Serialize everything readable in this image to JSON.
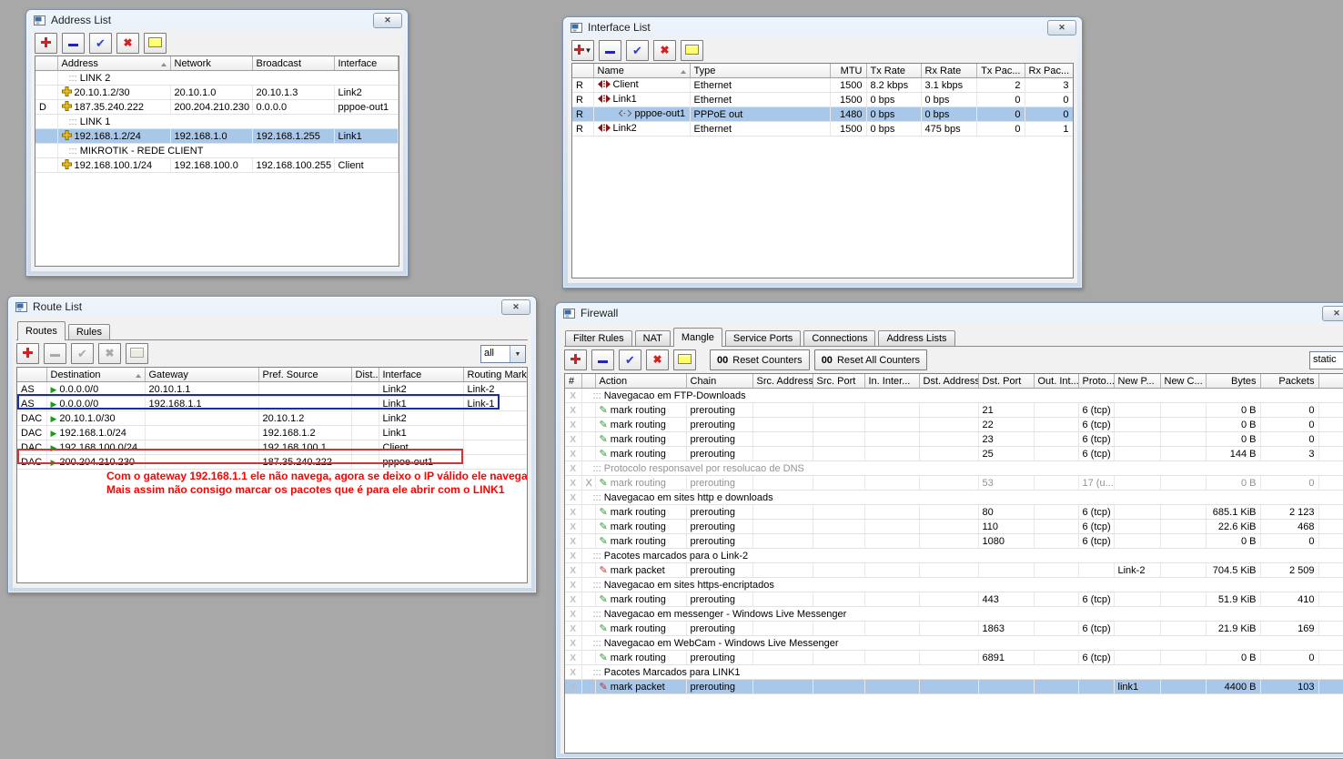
{
  "desktop": {
    "background_color": "#a8a8a8"
  },
  "colors": {
    "selection": "#a9c7e9",
    "annotation_red": "#ff0000",
    "outline_blue": "#1c2f9e",
    "outline_red": "#d03434"
  },
  "windows": {
    "address_list": {
      "title": "Address List",
      "toolbar": [
        {
          "icon": "add-icon"
        },
        {
          "icon": "remove-icon"
        },
        {
          "icon": "enable-icon"
        },
        {
          "icon": "disable-icon"
        },
        {
          "icon": "comment-icon"
        }
      ],
      "columns": [
        "Address",
        "Network",
        "Broadcast",
        "Interface"
      ],
      "sort_column": "Address",
      "rows": [
        {
          "kind": "comment",
          "text": "LINK 2"
        },
        {
          "kind": "item",
          "flag": "",
          "icon": "address-icon",
          "address": "20.10.1.2/30",
          "network": "20.10.1.0",
          "broadcast": "20.10.1.3",
          "interface": "Link2"
        },
        {
          "kind": "item",
          "flag": "D",
          "icon": "address-icon",
          "address": "187.35.240.222",
          "network": "200.204.210.230",
          "broadcast": "0.0.0.0",
          "interface": "pppoe-out1"
        },
        {
          "kind": "comment",
          "text": "LINK 1"
        },
        {
          "kind": "item",
          "flag": "",
          "icon": "address-icon",
          "address": "192.168.1.2/24",
          "network": "192.168.1.0",
          "broadcast": "192.168.1.255",
          "interface": "Link1",
          "selected": true
        },
        {
          "kind": "comment",
          "text": "MIKROTIK - REDE CLIENT"
        },
        {
          "kind": "item",
          "flag": "",
          "icon": "address-icon",
          "address": "192.168.100.1/24",
          "network": "192.168.100.0",
          "broadcast": "192.168.100.255",
          "interface": "Client"
        }
      ]
    },
    "interface_list": {
      "title": "Interface List",
      "toolbar": [
        {
          "icon": "add-icon",
          "caret": true
        },
        {
          "icon": "remove-icon"
        },
        {
          "icon": "enable-icon"
        },
        {
          "icon": "disable-icon"
        },
        {
          "icon": "comment-icon"
        }
      ],
      "columns": [
        "Name",
        "Type",
        "MTU",
        "Tx Rate",
        "Rx Rate",
        "Tx Pac...",
        "Rx Pac..."
      ],
      "sort_column": "Name",
      "rows": [
        {
          "flag": "R",
          "icon": "ethernet-icon",
          "name": "Client",
          "type": "Ethernet",
          "mtu": "1500",
          "tx_rate": "8.2 kbps",
          "rx_rate": "3.1 kbps",
          "tx_pac": "2",
          "rx_pac": "3"
        },
        {
          "flag": "R",
          "icon": "ethernet-icon",
          "name": "Link1",
          "type": "Ethernet",
          "mtu": "1500",
          "tx_rate": "0 bps",
          "rx_rate": "0 bps",
          "tx_pac": "0",
          "rx_pac": "0"
        },
        {
          "flag": "R",
          "icon": "pppoe-icon",
          "indent": true,
          "name": "pppoe-out1",
          "type": "PPPoE out",
          "mtu": "1480",
          "tx_rate": "0 bps",
          "rx_rate": "0 bps",
          "tx_pac": "0",
          "rx_pac": "0",
          "selected": true
        },
        {
          "flag": "R",
          "icon": "ethernet-icon",
          "name": "Link2",
          "type": "Ethernet",
          "mtu": "1500",
          "tx_rate": "0 bps",
          "rx_rate": "475 bps",
          "tx_pac": "0",
          "rx_pac": "1"
        }
      ]
    },
    "route_list": {
      "title": "Route List",
      "tabs": [
        {
          "label": "Routes",
          "active": true
        },
        {
          "label": "Rules"
        }
      ],
      "toolbar": [
        {
          "icon": "add-icon"
        },
        {
          "icon": "remove-icon",
          "disabled": true
        },
        {
          "icon": "enable-icon",
          "disabled": true
        },
        {
          "icon": "disable-icon",
          "disabled": true
        },
        {
          "icon": "comment-icon",
          "disabled": true
        }
      ],
      "filter_value": "all",
      "columns": [
        "Destination",
        "Gateway",
        "Pref. Source",
        "Dist...",
        "Interface",
        "Routing Mark"
      ],
      "sort_column": "Destination",
      "rows": [
        {
          "flags": "AS",
          "icon": "route-flag-icon",
          "destination": "0.0.0.0/0",
          "gateway": "20.10.1.1",
          "pref_source": "",
          "distance": "",
          "interface": "Link2",
          "routing_mark": "Link-2"
        },
        {
          "flags": "AS",
          "icon": "route-flag-icon",
          "destination": "0.0.0.0/0",
          "gateway": "192.168.1.1",
          "pref_source": "",
          "distance": "",
          "interface": "Link1",
          "routing_mark": "Link-1",
          "outline": "blue"
        },
        {
          "flags": "DAC",
          "icon": "route-flag-icon",
          "destination": "20.10.1.0/30",
          "gateway": "",
          "pref_source": "20.10.1.2",
          "distance": "",
          "interface": "Link2",
          "routing_mark": ""
        },
        {
          "flags": "DAC",
          "icon": "route-flag-icon",
          "destination": "192.168.1.0/24",
          "gateway": "",
          "pref_source": "192.168.1.2",
          "distance": "",
          "interface": "Link1",
          "routing_mark": ""
        },
        {
          "flags": "DAC",
          "icon": "route-flag-icon",
          "destination": "192.168.100.0/24",
          "gateway": "",
          "pref_source": "192.168.100.1",
          "distance": "",
          "interface": "Client",
          "routing_mark": ""
        },
        {
          "flags": "DAC",
          "icon": "route-flag-icon",
          "destination": "200.204.210.230",
          "gateway": "",
          "pref_source": "187.35.240.222",
          "distance": "",
          "interface": "pppoe-out1",
          "routing_mark": "",
          "outline": "red"
        }
      ],
      "annotation": {
        "color": "#ff0000",
        "lines": [
          "Com o gateway 192.168.1.1 ele não navega, agora se deixo o IP válido ele navega.",
          "Mais assim não consigo marcar os pacotes que é para ele abrir com o LINK1"
        ]
      }
    },
    "firewall": {
      "title": "Firewall",
      "tabs": [
        {
          "label": "Filter Rules"
        },
        {
          "label": "NAT"
        },
        {
          "label": "Mangle",
          "active": true
        },
        {
          "label": "Service Ports"
        },
        {
          "label": "Connections"
        },
        {
          "label": "Address Lists"
        }
      ],
      "toolbar": [
        {
          "icon": "add-icon"
        },
        {
          "icon": "remove-icon"
        },
        {
          "icon": "enable-icon"
        },
        {
          "icon": "disable-icon"
        },
        {
          "icon": "comment-icon"
        }
      ],
      "buttons": [
        {
          "prefix": "00",
          "label": "Reset Counters"
        },
        {
          "prefix": "00",
          "label": "Reset All Counters"
        }
      ],
      "filter_value": "static",
      "columns": [
        "#",
        "Action",
        "Chain",
        "Src. Address",
        "Src. Port",
        "In. Inter...",
        "Dst. Address",
        "Dst. Port",
        "Out. Int...",
        "Proto...",
        "New P...",
        "New C...",
        "Bytes",
        "Packets"
      ],
      "rows": [
        {
          "kind": "comment",
          "text": "Navegacao em FTP-Downloads"
        },
        {
          "kind": "rule",
          "icon": "mark-routing-icon",
          "action": "mark routing",
          "chain": "prerouting",
          "dst_port": "21",
          "proto": "6 (tcp)",
          "new_packet_mark": "",
          "bytes": "0 B",
          "packets": "0"
        },
        {
          "kind": "rule",
          "icon": "mark-routing-icon",
          "action": "mark routing",
          "chain": "prerouting",
          "dst_port": "22",
          "proto": "6 (tcp)",
          "new_packet_mark": "",
          "bytes": "0 B",
          "packets": "0"
        },
        {
          "kind": "rule",
          "icon": "mark-routing-icon",
          "action": "mark routing",
          "chain": "prerouting",
          "dst_port": "23",
          "proto": "6 (tcp)",
          "new_packet_mark": "",
          "bytes": "0 B",
          "packets": "0"
        },
        {
          "kind": "rule",
          "icon": "mark-routing-icon",
          "action": "mark routing",
          "chain": "prerouting",
          "dst_port": "25",
          "proto": "6 (tcp)",
          "new_packet_mark": "",
          "bytes": "144 B",
          "packets": "3"
        },
        {
          "kind": "comment",
          "text": "Protocolo responsavel por resolucao de DNS",
          "muted": true
        },
        {
          "kind": "rule",
          "disabled": true,
          "flag": "X",
          "icon": "mark-routing-icon",
          "action": "mark routing",
          "chain": "prerouting",
          "dst_port": "53",
          "proto": "17 (u...",
          "new_packet_mark": "",
          "bytes": "0 B",
          "packets": "0"
        },
        {
          "kind": "comment",
          "text": "Navegacao em sites http e downloads"
        },
        {
          "kind": "rule",
          "icon": "mark-routing-icon",
          "action": "mark routing",
          "chain": "prerouting",
          "dst_port": "80",
          "proto": "6 (tcp)",
          "new_packet_mark": "",
          "bytes": "685.1 KiB",
          "packets": "2 123"
        },
        {
          "kind": "rule",
          "icon": "mark-routing-icon",
          "action": "mark routing",
          "chain": "prerouting",
          "dst_port": "110",
          "proto": "6 (tcp)",
          "new_packet_mark": "",
          "bytes": "22.6 KiB",
          "packets": "468"
        },
        {
          "kind": "rule",
          "icon": "mark-routing-icon",
          "action": "mark routing",
          "chain": "prerouting",
          "dst_port": "1080",
          "proto": "6 (tcp)",
          "new_packet_mark": "",
          "bytes": "0 B",
          "packets": "0"
        },
        {
          "kind": "comment",
          "text": "Pacotes marcados para o Link-2"
        },
        {
          "kind": "rule",
          "icon": "mark-packet-icon",
          "action": "mark packet",
          "chain": "prerouting",
          "dst_port": "",
          "proto": "",
          "new_packet_mark": "Link-2",
          "bytes": "704.5 KiB",
          "packets": "2 509"
        },
        {
          "kind": "comment",
          "text": "Navegacao em sites https-encriptados"
        },
        {
          "kind": "rule",
          "icon": "mark-routing-icon",
          "action": "mark routing",
          "chain": "prerouting",
          "dst_port": "443",
          "proto": "6 (tcp)",
          "new_packet_mark": "",
          "bytes": "51.9 KiB",
          "packets": "410"
        },
        {
          "kind": "comment",
          "text": "Navegacao em messenger - Windows Live Messenger"
        },
        {
          "kind": "rule",
          "icon": "mark-routing-icon",
          "action": "mark routing",
          "chain": "prerouting",
          "dst_port": "1863",
          "proto": "6 (tcp)",
          "new_packet_mark": "",
          "bytes": "21.9 KiB",
          "packets": "169"
        },
        {
          "kind": "comment",
          "text": "Navegacao em WebCam - Windows Live Messenger"
        },
        {
          "kind": "rule",
          "icon": "mark-routing-icon",
          "action": "mark routing",
          "chain": "prerouting",
          "dst_port": "6891",
          "proto": "6 (tcp)",
          "new_packet_mark": "",
          "bytes": "0 B",
          "packets": "0"
        },
        {
          "kind": "comment",
          "text": "Pacotes Marcados para LINK1"
        },
        {
          "kind": "rule",
          "icon": "mark-packet-icon",
          "action": "mark packet",
          "chain": "prerouting",
          "dst_port": "",
          "proto": "",
          "new_packet_mark": "link1",
          "bytes": "4400 B",
          "packets": "103",
          "selected": true
        }
      ]
    }
  }
}
